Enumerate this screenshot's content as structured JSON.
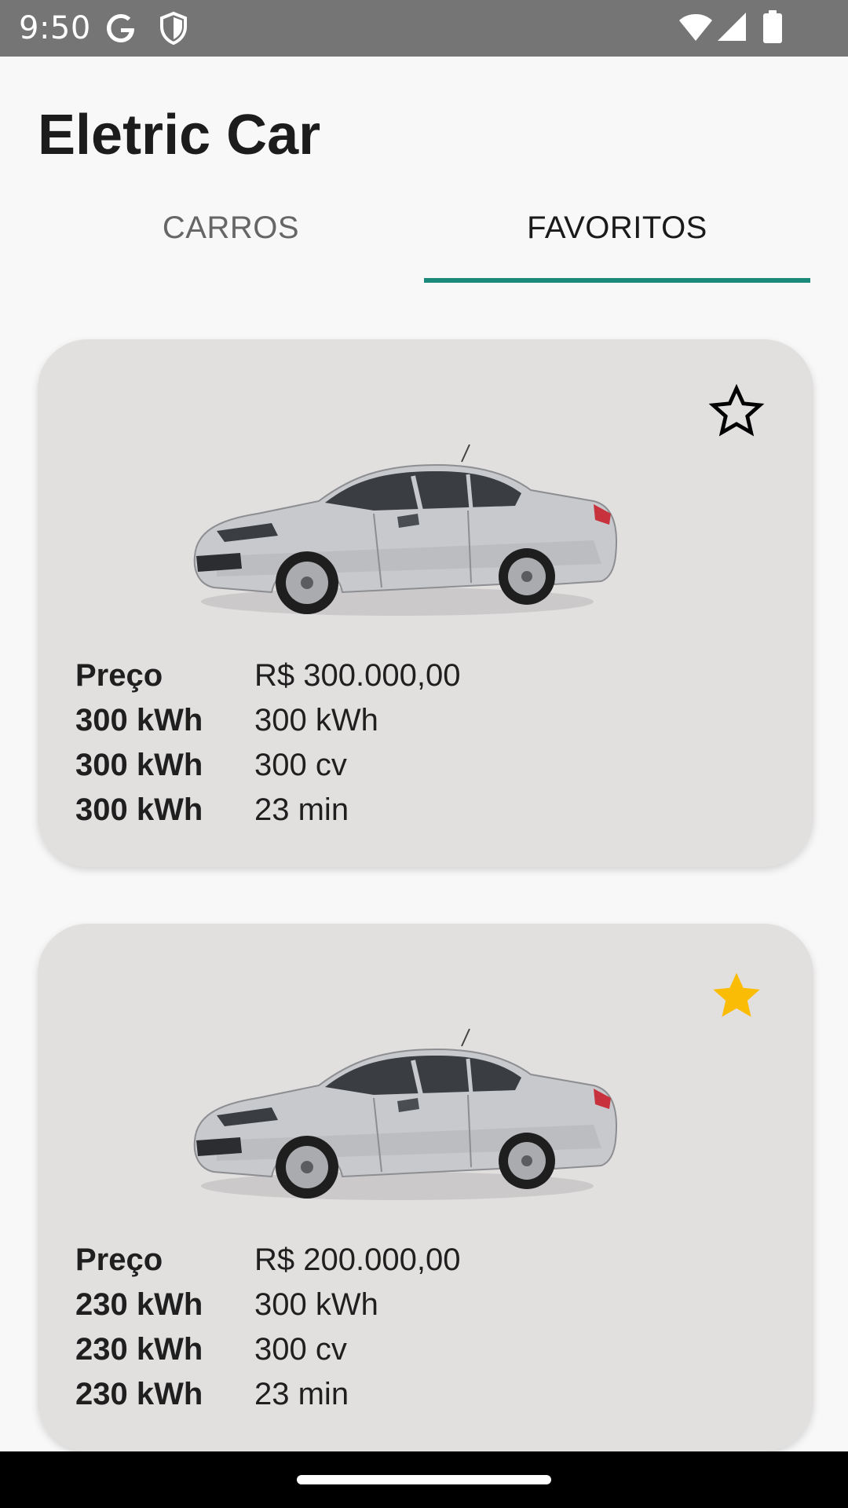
{
  "status_bar": {
    "time": "9:50",
    "icons": [
      "google-icon",
      "shield-icon",
      "wifi-icon",
      "signal-icon",
      "battery-icon"
    ]
  },
  "header": {
    "title": "Eletric Car"
  },
  "tabs": [
    {
      "label": "CARROS",
      "selected": false
    },
    {
      "label": "FAVORITOS",
      "selected": true
    }
  ],
  "colors": {
    "accent": "#1c8a7a",
    "card_background": "#e2dfdf",
    "favorite_active": "#fbbc05",
    "page_background": "#f8f8f8"
  },
  "cars": [
    {
      "favorite": false,
      "favorite_icon": "star-outline-icon",
      "image": "silver-sedan-image",
      "specs": [
        {
          "label": "Preço",
          "value": "R$ 300.000,00"
        },
        {
          "label": "300 kWh",
          "value": "300 kWh"
        },
        {
          "label": "300 kWh",
          "value": "300 cv"
        },
        {
          "label": "300 kWh",
          "value": "23 min"
        }
      ]
    },
    {
      "favorite": true,
      "favorite_icon": "star-filled-icon",
      "image": "silver-sedan-image",
      "specs": [
        {
          "label": "Preço",
          "value": "R$ 200.000,00"
        },
        {
          "label": "230 kWh",
          "value": "300 kWh"
        },
        {
          "label": "230 kWh",
          "value": "300 cv"
        },
        {
          "label": "230 kWh",
          "value": "23 min"
        }
      ]
    }
  ]
}
